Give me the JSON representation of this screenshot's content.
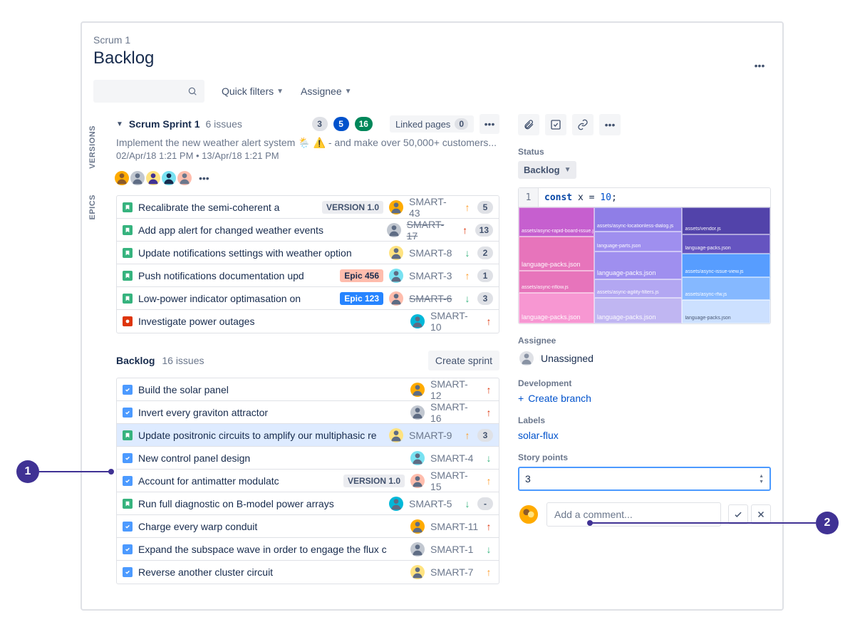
{
  "breadcrumb": "Scrum 1",
  "page_title": "Backlog",
  "filters": {
    "quick": "Quick filters",
    "assignee": "Assignee"
  },
  "side_tabs": [
    "VERSIONS",
    "EPICS"
  ],
  "sprint": {
    "name": "Scrum Sprint 1",
    "issue_count": "6 issues",
    "pills": {
      "todo": "3",
      "inprogress": "5",
      "done": "16"
    },
    "linked_pages_label": "Linked pages",
    "linked_pages_count": "0",
    "description": "Implement the new weather alert system 🌦️ ⚠️ - and make over 50,000+ customers...",
    "dates": "02/Apr/18 1:21 PM • 13/Apr/18 1:21 PM",
    "issues": [
      {
        "type": "story",
        "title": "Recalibrate the semi-coherent a",
        "version": "VERSION 1.0",
        "key": "SMART-43",
        "prio": "medium",
        "est": "5"
      },
      {
        "type": "story",
        "title": "Add app alert for changed weather events",
        "key": "SMART-17",
        "struck": true,
        "prio": "high",
        "est": "13"
      },
      {
        "type": "story",
        "title": "Update notifications settings with weather option",
        "key": "SMART-8",
        "prio": "low",
        "est": "2"
      },
      {
        "type": "story",
        "title": "Push notifications documentation upd",
        "epic": "Epic 456",
        "epicColor": "orange",
        "key": "SMART-3",
        "prio": "medium",
        "est": "1"
      },
      {
        "type": "story",
        "title": "Low-power indicator optimasation on",
        "epic": "Epic 123",
        "epicColor": "blue",
        "key": "SMART-6",
        "struck": true,
        "prio": "low",
        "est": "3"
      },
      {
        "type": "bug",
        "title": "Investigate power outages",
        "key": "SMART-10",
        "prio": "high"
      }
    ]
  },
  "backlog": {
    "title": "Backlog",
    "issue_count": "16 issues",
    "create_sprint": "Create sprint",
    "issues": [
      {
        "type": "task",
        "title": "Build the solar panel",
        "key": "SMART-12",
        "prio": "high"
      },
      {
        "type": "task",
        "title": "Invert every graviton attractor",
        "key": "SMART-16",
        "prio": "high"
      },
      {
        "type": "story",
        "title": "Update positronic circuits to amplify our multiphasic re",
        "key": "SMART-9",
        "prio": "medium",
        "est": "3",
        "selected": true
      },
      {
        "type": "task",
        "title": "New control panel design",
        "key": "SMART-4",
        "prio": "low"
      },
      {
        "type": "task",
        "title": "Account for antimatter modulatc",
        "version": "VERSION 1.0",
        "key": "SMART-15",
        "prio": "medium"
      },
      {
        "type": "story",
        "title": "Run full diagnostic on B-model power arrays",
        "key": "SMART-5",
        "prio": "low",
        "est": "-"
      },
      {
        "type": "task",
        "title": "Charge every warp conduit",
        "key": "SMART-11",
        "prio": "high"
      },
      {
        "type": "task",
        "title": "Expand the subspace wave in order to engage the flux c",
        "key": "SMART-1",
        "prio": "low"
      },
      {
        "type": "task",
        "title": "Reverse another cluster circuit",
        "key": "SMART-7",
        "prio": "medium"
      }
    ]
  },
  "detail": {
    "status_label": "Status",
    "status_value": "Backlog",
    "code_line": "1",
    "code_kw": "const",
    "code_var": "x",
    "code_eq": "=",
    "code_num": "10",
    "code_semi": ";",
    "assignee_label": "Assignee",
    "assignee_value": "Unassigned",
    "dev_label": "Development",
    "create_branch": "Create branch",
    "labels_label": "Labels",
    "label_value": "solar-flux",
    "sp_label": "Story points",
    "sp_value": "3",
    "comment_placeholder": "Add a comment..."
  },
  "annotations": {
    "a1": "1",
    "a2": "2"
  }
}
